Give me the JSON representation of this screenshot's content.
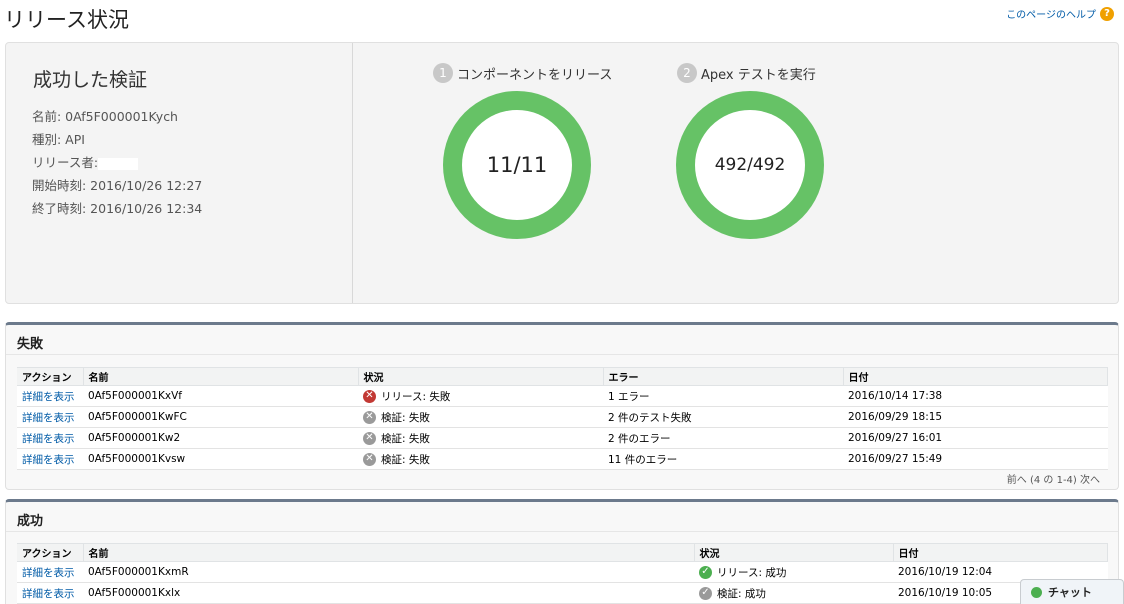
{
  "page": {
    "title": "リリース状況",
    "help_label": "このページのヘルプ",
    "help_icon": "?"
  },
  "summary": {
    "title": "成功した検証",
    "info": [
      "名前: 0Af5F000001Kych",
      "種別: API",
      "リリース者:",
      "開始時刻: 2016/10/26 12:27",
      "終了時刻: 2016/10/26 12:34"
    ],
    "steps": [
      {
        "num": "1",
        "label": "コンポーネントをリリース",
        "value": "11/11",
        "progress": 1.0
      },
      {
        "num": "2",
        "label": "Apex テストを実行",
        "value": "492/492",
        "progress": 1.0
      }
    ],
    "ring_color": "#66c266"
  },
  "failed": {
    "title": "失敗",
    "headers": [
      "アクション",
      "名前",
      "状況",
      "エラー",
      "日付"
    ],
    "rows": [
      {
        "action": "詳細を表示",
        "name": "0Af5F000001KxVf",
        "status": "リリース: 失敗",
        "status_icon": "error-icon",
        "error": "1 エラー",
        "date": "2016/10/14 17:38"
      },
      {
        "action": "詳細を表示",
        "name": "0Af5F000001KwFC",
        "status": "検証: 失敗",
        "status_icon": "gray-x-icon",
        "error": "2 件のテスト失敗",
        "date": "2016/09/29 18:15"
      },
      {
        "action": "詳細を表示",
        "name": "0Af5F000001Kw2",
        "status": "検証: 失敗",
        "status_icon": "gray-x-icon",
        "error": "2 件のエラー",
        "date": "2016/09/27 16:01"
      },
      {
        "action": "詳細を表示",
        "name": "0Af5F000001Kvsw",
        "status": "検証: 失敗",
        "status_icon": "gray-x-icon",
        "error": "11 件のエラー",
        "date": "2016/09/27 15:49"
      }
    ],
    "pager": "前へ (4 の 1-4) 次へ"
  },
  "success": {
    "title": "成功",
    "headers": [
      "アクション",
      "名前",
      "状況",
      "日付"
    ],
    "rows": [
      {
        "action": "詳細を表示",
        "name": "0Af5F000001KxmR",
        "status": "リリース: 成功",
        "status_icon": "green-check-icon",
        "date": "2016/10/19 12:04"
      },
      {
        "action": "詳細を表示",
        "name": "0Af5F000001Kxlx",
        "status": "検証: 成功",
        "status_icon": "gray-check-icon",
        "date": "2016/10/19 10:05"
      }
    ]
  },
  "chat": {
    "label": "チャット"
  }
}
